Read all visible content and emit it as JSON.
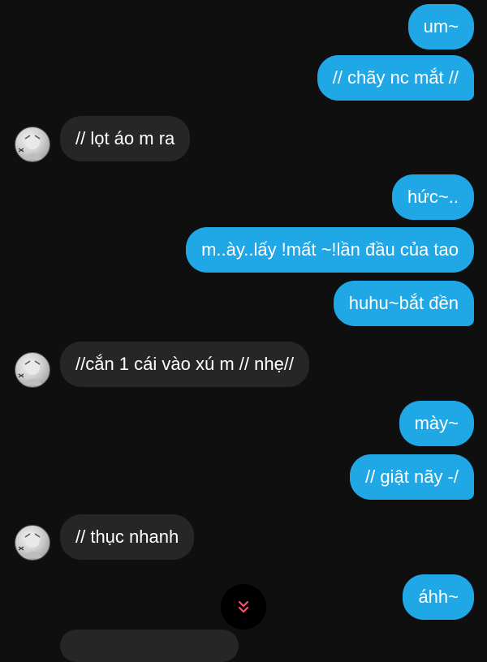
{
  "messages": [
    {
      "direction": "out",
      "text": "um~"
    },
    {
      "direction": "out",
      "text": "// chãy nc mắt //"
    },
    {
      "direction": "in",
      "text": "// lọt áo m ra"
    },
    {
      "direction": "out",
      "text": "hức~.."
    },
    {
      "direction": "out",
      "text": "m..ày..lấy !mất ~!lần đầu của tao"
    },
    {
      "direction": "out",
      "text": "huhu~bắt đền"
    },
    {
      "direction": "in",
      "text": "//cắn 1 cái vào xú m // nhẹ//"
    },
    {
      "direction": "out",
      "text": "mày~"
    },
    {
      "direction": "out",
      "text": "// giật nãy -/"
    },
    {
      "direction": "in",
      "text": "// thục nhanh"
    },
    {
      "direction": "out",
      "text": "áhh~"
    }
  ],
  "scroll_button": {
    "icon": "double-chevron-down-icon",
    "color": "#ff4d6d"
  },
  "colors": {
    "outgoing": "#1fa7e6",
    "incoming": "#262626",
    "background": "#0f0f0f"
  }
}
